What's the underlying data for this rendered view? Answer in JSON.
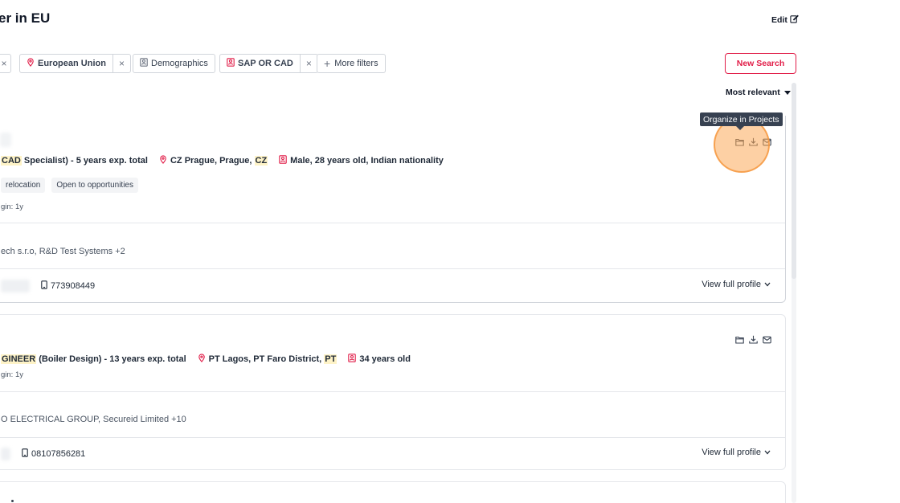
{
  "header": {
    "title": "er in EU",
    "edit_label": "Edit"
  },
  "filters": {
    "chip_location": "European Union",
    "chip_demographics": "Demographics",
    "chip_keywords": "SAP OR CAD",
    "more_filters": "More filters",
    "close_glyph": "×",
    "plus_glyph": "+"
  },
  "toolbar": {
    "new_search": "New Search",
    "sort_label": "Most relevant"
  },
  "tooltip": {
    "text": "Organize in Projects"
  },
  "results": [
    {
      "title_highlight": "CAD",
      "title_rest": " Specialist) - 5 years exp. total",
      "location_prefix": "CZ Prague, Prague, ",
      "location_highlight": "CZ",
      "demographics": "Male, 28 years old, Indian nationality",
      "tags": [
        "relocation",
        "Open to opportunities"
      ],
      "last_login": "gin: 1y",
      "companies": "ech s.r.o, R&D Test Systems +2",
      "phone": "773908449",
      "view_profile": "View full profile"
    },
    {
      "title_highlight": "GINEER",
      "title_rest": " (Boiler Design) - 13 years exp. total",
      "location_prefix": "PT Lagos, PT Faro District, ",
      "location_highlight": "PT",
      "demographics": "34 years old",
      "last_login": "gin: 1y",
      "companies": "O ELECTRICAL GROUP, Secureid Limited +10",
      "phone": "08107856281",
      "view_profile": "View full profile"
    }
  ],
  "icons": {
    "pin": "map-pin-icon",
    "person": "person-card-icon",
    "folder": "folder-icon",
    "download": "download-icon",
    "mail": "mail-icon",
    "phone": "phone-icon",
    "chevron": "chevron-down-icon",
    "caret": "caret-down-icon",
    "edit": "edit-icon"
  },
  "colors": {
    "accent": "#e11d48",
    "highlight": "#fef3c7",
    "tooltip_bg": "#374151"
  }
}
